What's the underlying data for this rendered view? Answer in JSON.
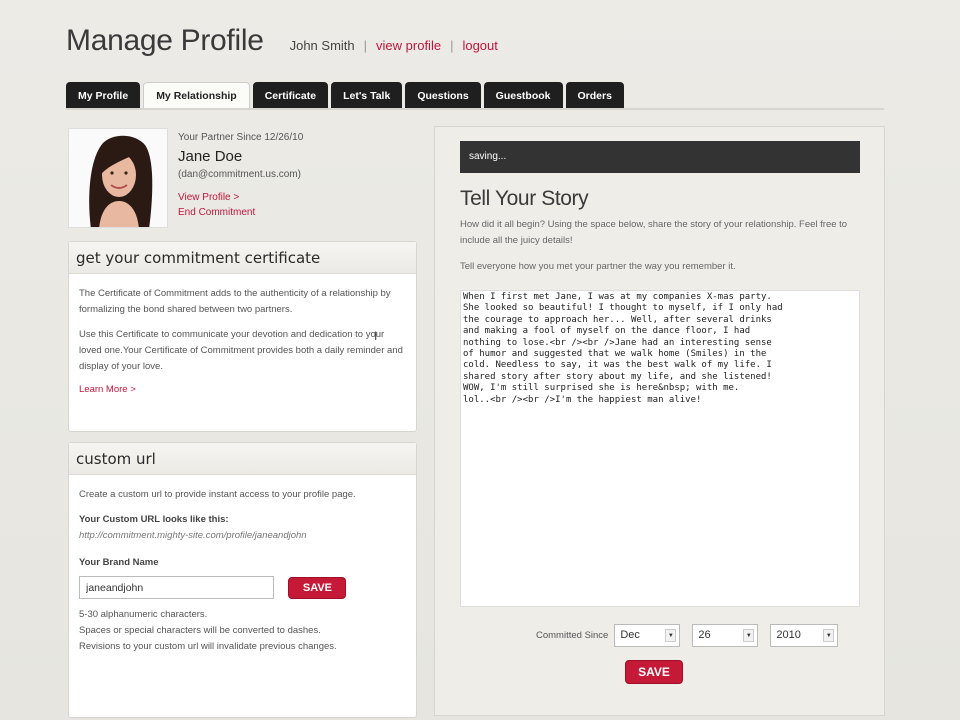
{
  "header": {
    "title": "Manage Profile",
    "user_name": "John Smith",
    "view_profile": "view profile",
    "logout": "logout",
    "separator": "|"
  },
  "tabs": [
    {
      "label": "My Profile",
      "active": false
    },
    {
      "label": "My Relationship",
      "active": true
    },
    {
      "label": "Certificate",
      "active": false
    },
    {
      "label": "Let's Talk",
      "active": false
    },
    {
      "label": "Questions",
      "active": false
    },
    {
      "label": "Guestbook",
      "active": false
    },
    {
      "label": "Orders",
      "active": false
    }
  ],
  "partner": {
    "since": "Your Partner Since 12/26/10",
    "name": "Jane Doe",
    "email": "(dan@commitment.us.com)",
    "view_profile": "View Profile >",
    "end_commitment": "End Commitment"
  },
  "certificate_box": {
    "title": "get your commitment certificate",
    "p1": "The Certificate of Commitment adds to the authenticity of a relationship by formalizing the bond shared between two partners.",
    "p2": "Use this Certificate to communicate your devotion and dedication to your loved one.Your Certificate of Commitment provides both a daily reminder and display of your love.",
    "learn_more": "Learn More >"
  },
  "custom_url_box": {
    "title": "custom url",
    "intro": "Create a custom url to provide instant access to your profile page.",
    "looks_like_label": "Your Custom URL looks like this:",
    "example_url": "http://commitment.mighty-site.com/profile/janeandjohn",
    "brand_label": "Your Brand Name",
    "brand_value": "janeandjohn",
    "save": "SAVE",
    "note1": "5-30 alphanumeric characters.",
    "note2": "Spaces or special characters will be converted to dashes.",
    "note3": "Revisions to your custom url will invalidate previous changes."
  },
  "story": {
    "status": "saving...",
    "title": "Tell Your Story",
    "desc": "How did it all begin? Using the space below, share the story of your relationship. Feel free to include all the juicy details!",
    "tell": "Tell everyone how you met your partner the way you remember it.",
    "text": "When I first met Jane, I was at my companies X-mas party.\nShe looked so beautiful! I thought to myself, if I only had\nthe courage to approach her... Well, after several drinks\nand making a fool of myself on the dance floor, I had\nnothing to lose.<br /><br />Jane had an interesting sense\nof humor and suggested that we walk home (Smiles) in the\ncold. Needless to say, it was the best walk of my life. I\nshared story after story about my life, and she listened!\nWOW, I'm still surprised she is here&nbsp; with me.\nlol..<br /><br />I'm the happiest man alive!",
    "committed_label": "Committed Since",
    "month": "Dec",
    "day": "26",
    "year": "2010",
    "save": "SAVE"
  },
  "icons": {
    "dropdown": "chevron-down-icon",
    "cursor": "text-cursor-icon"
  }
}
